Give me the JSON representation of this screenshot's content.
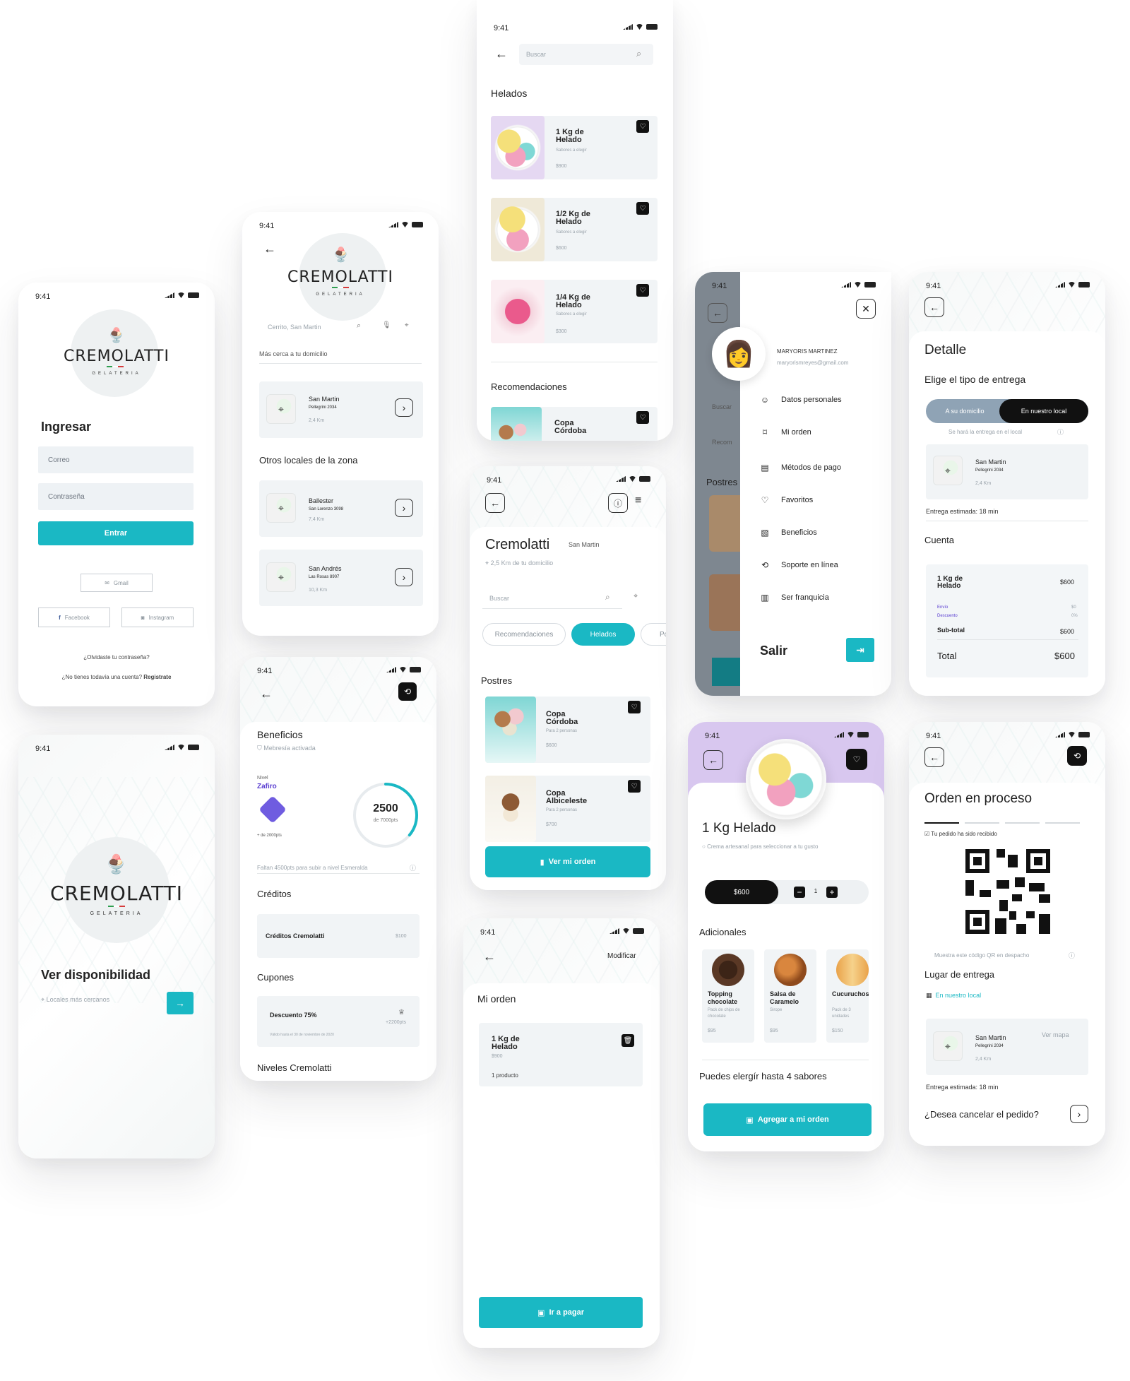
{
  "status_time": "9:41",
  "brand": {
    "name": "CREMOLATTI",
    "tagline": "GELATERIA"
  },
  "login": {
    "title": "Ingresar",
    "email_placeholder": "Correo",
    "password_placeholder": "Contraseña",
    "enter": "Entrar",
    "gmail": "Gmail",
    "facebook": "Facebook",
    "instagram": "Instagram",
    "forgot": "¿Olvidaste tu contraseña?",
    "no_account": "¿No tienes todavía una cuenta?",
    "register": "Registrate"
  },
  "availability": {
    "title": "Ver disponibilidad",
    "placeholder": "Locales más cercanos"
  },
  "stores": {
    "search_placeholder": "Cerrito, San Martin",
    "nearest": "Más cerca a tu domicilio",
    "other": "Otros locales de la zona",
    "list": [
      {
        "name": "San Martin",
        "address": "Pellegrini 2034",
        "dist": "2,4 Km"
      },
      {
        "name": "Ballester",
        "address": "San Lorenzo 3098",
        "dist": "7,4 Km"
      },
      {
        "name": "San Andrés",
        "address": "Las Rosas 8907",
        "dist": "10,3 Km"
      }
    ]
  },
  "benefits": {
    "title": "Beneficios",
    "membership": "Mebresía activada",
    "level_label": "Nivel",
    "level": "Zafiro",
    "level_min": "+ de 2000pts",
    "points": "2500",
    "points_of": "de 7000pts",
    "progress": 0.36,
    "missing": "Faltan 4500pts para subir a nivel Esmeralda",
    "credits_title": "Créditos",
    "credits_name": "Créditos Cremolatti",
    "credits_value": "$100",
    "coupons_title": "Cupones",
    "coupon_name": "Descuento 75%",
    "coupon_pts": "+2200pts",
    "coupon_valid": "Válido hasta el 30 de noviembre de 2020",
    "levels_title": "Niveles Cremolatti"
  },
  "search": {
    "placeholder": "Buscar",
    "section": "Helados",
    "reco": "Recomendaciones",
    "items": [
      {
        "name": "1 Kg de Helado",
        "desc": "Sabores a elegir",
        "price": "$900"
      },
      {
        "name": "1/2 Kg de Helado",
        "desc": "Sabores a elegir",
        "price": "$600"
      },
      {
        "name": "1/4 Kg de Helado",
        "desc": "Sabores a elegir",
        "price": "$300"
      }
    ],
    "reco_item": "Copa Córdoba"
  },
  "store": {
    "name": "Cremolatti",
    "branch": "San Martin",
    "distance": "2,5 Km de tu domicilio",
    "search": "Buscar",
    "tabs": [
      "Recomendaciones",
      "Helados",
      "Po"
    ],
    "section": "Postres",
    "items": [
      {
        "name": "Copa Córdoba",
        "desc": "Para 2 personas",
        "price": "$600"
      },
      {
        "name": "Copa Albiceleste",
        "desc": "Para 2 personas",
        "price": "$700"
      }
    ],
    "cta": "Ver mi orden"
  },
  "order": {
    "modify": "Modificar",
    "title": "Mi orden",
    "item": "1 Kg de Helado",
    "price": "$900",
    "count": "1 producto",
    "pay": "Ir a pagar"
  },
  "menu": {
    "user": "MARYORIS MARTINEZ",
    "email": "maryorismreyes@gmail.com",
    "items": [
      "Datos personales",
      "Mi orden",
      "Métodos de pago",
      "Favoritos",
      "Beneficios",
      "Soporte en línea",
      "Ser franquicia"
    ],
    "logout": "Salir",
    "behind_search": "Buscar",
    "behind_reco": "Recom",
    "behind_section": "Postres"
  },
  "product": {
    "title": "1 Kg Helado",
    "desc": "Crema artesanal para seleccionar a tu gusto",
    "price": "$600",
    "qty": "1",
    "addons_title": "Adicionales",
    "addons": [
      {
        "name": "Topping chocolate",
        "desc": "Pack de chips de chocolate",
        "price": "$95"
      },
      {
        "name": "Salsa de Caramelo",
        "desc": "Sirope",
        "price": "$95"
      },
      {
        "name": "Cucuruchos 120gr",
        "desc": "Pack de 3 unidades",
        "price": "$150"
      }
    ],
    "flavors": "Puedes elergír hasta 4 sabores",
    "cta": "Agregar a mi orden"
  },
  "detail": {
    "title": "Detalle",
    "delivery_title": "Elige el tipo de entrega",
    "opt_home": "A su domicilio",
    "opt_local": "En nuestro local",
    "note": "Se hará la entrega en el local",
    "eta": "Entrega estimada:  18 min",
    "account": "Cuenta",
    "item": "1 Kg de Helado",
    "item_price": "$600",
    "shipping": "Envío",
    "shipping_val": "$0",
    "discount": "Descuento",
    "discount_val": "0%",
    "subtotal": "Sub-total",
    "subtotal_val": "$600",
    "total": "Total",
    "total_val": "$600"
  },
  "progress_screen": {
    "title": "Orden en proceso",
    "received": "Tu pedido ha sido recibido",
    "qr_note": "Muestra este código QR en despacho",
    "place_title": "Lugar de entrega",
    "place": "En nuestro local",
    "see_map": "Ver mapa",
    "eta": "Entrega estimada:  18 min",
    "cancel": "¿Desea cancelar el pedido?"
  },
  "colors": {
    "accent": "#1ab8c4",
    "lilac": "#d8c7ef",
    "dark": "#111111"
  }
}
